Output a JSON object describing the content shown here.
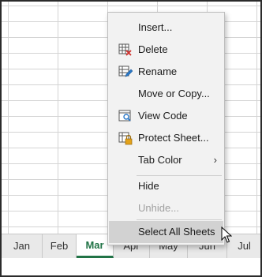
{
  "sheet_tabs": [
    {
      "label": "Jan",
      "active": false
    },
    {
      "label": "Feb",
      "active": false
    },
    {
      "label": "Mar",
      "active": true
    },
    {
      "label": "Apr",
      "active": false
    },
    {
      "label": "May",
      "active": false
    },
    {
      "label": "Jun",
      "active": false
    },
    {
      "label": "Jul",
      "active": false
    }
  ],
  "context_menu": {
    "items": [
      {
        "label": "Insert...",
        "icon": null,
        "enabled": true
      },
      {
        "label": "Delete",
        "icon": "delete-sheet-icon",
        "enabled": true
      },
      {
        "label": "Rename",
        "icon": "rename-sheet-icon",
        "enabled": true
      },
      {
        "label": "Move or Copy...",
        "icon": null,
        "enabled": true
      },
      {
        "label": "View Code",
        "icon": "view-code-icon",
        "enabled": true
      },
      {
        "label": "Protect Sheet...",
        "icon": "protect-sheet-icon",
        "enabled": true
      },
      {
        "label": "Tab Color",
        "icon": null,
        "enabled": true,
        "submenu": true
      },
      {
        "label": "Hide",
        "icon": null,
        "enabled": true
      },
      {
        "label": "Unhide...",
        "icon": null,
        "enabled": false
      },
      {
        "label": "Select All Sheets",
        "icon": null,
        "enabled": true,
        "highlighted": true
      }
    ],
    "submenu_arrow": "›"
  },
  "colors": {
    "accent": "#217346",
    "menu_bg": "#f2f2f2",
    "highlight": "#d2d2d2",
    "disabled_text": "#a0a0a0"
  }
}
